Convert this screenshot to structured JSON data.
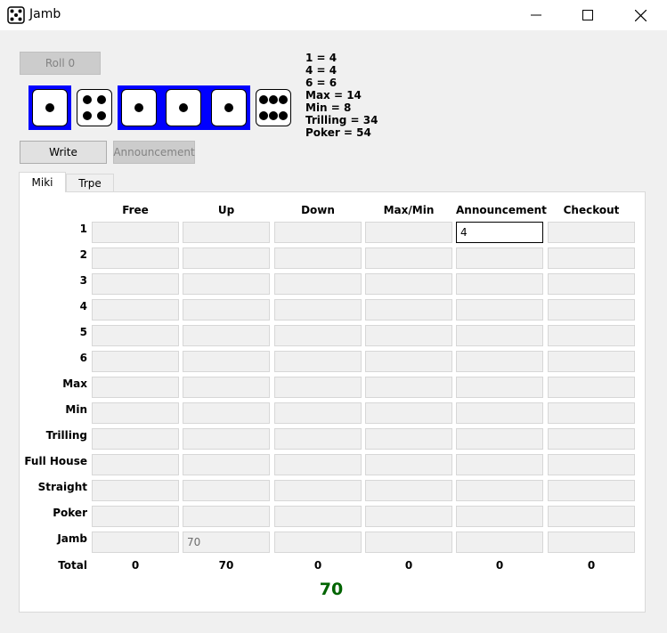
{
  "window": {
    "title": "Jamb",
    "app_icon": "dice-icon"
  },
  "controls": {
    "roll_label": "Roll 0",
    "write_label": "Write",
    "announcement_label": "Announcement"
  },
  "dice": [
    {
      "value": 1,
      "held": true
    },
    {
      "value": 4,
      "held": false
    },
    {
      "value": 1,
      "held": true
    },
    {
      "value": 1,
      "held": true
    },
    {
      "value": 1,
      "held": true
    },
    {
      "value": 6,
      "held": false
    }
  ],
  "info_lines": [
    "1 = 4",
    "4 = 4",
    "6 = 6",
    "Max = 14",
    "Min = 8",
    "Trilling = 34",
    "Poker = 54"
  ],
  "tabs": [
    {
      "label": "Miki",
      "active": true
    },
    {
      "label": "Trpe",
      "active": false
    }
  ],
  "columns": [
    "Free",
    "Up",
    "Down",
    "Max/Min",
    "Announcement",
    "Checkout"
  ],
  "rows": [
    "1",
    "2",
    "3",
    "4",
    "5",
    "6",
    "Max",
    "Min",
    "Trilling",
    "Full House",
    "Straight",
    "Poker",
    "Jamb"
  ],
  "cells": [
    [
      "",
      "",
      "",
      "",
      "4",
      ""
    ],
    [
      "",
      "",
      "",
      "",
      "",
      ""
    ],
    [
      "",
      "",
      "",
      "",
      "",
      ""
    ],
    [
      "",
      "",
      "",
      "",
      "",
      ""
    ],
    [
      "",
      "",
      "",
      "",
      "",
      ""
    ],
    [
      "",
      "",
      "",
      "",
      "",
      ""
    ],
    [
      "",
      "",
      "",
      "",
      "",
      ""
    ],
    [
      "",
      "",
      "",
      "",
      "",
      ""
    ],
    [
      "",
      "",
      "",
      "",
      "",
      ""
    ],
    [
      "",
      "",
      "",
      "",
      "",
      ""
    ],
    [
      "",
      "",
      "",
      "",
      "",
      ""
    ],
    [
      "",
      "",
      "",
      "",
      "",
      ""
    ],
    [
      "",
      "70",
      "",
      "",
      "",
      ""
    ]
  ],
  "active_cell": {
    "row": 0,
    "col": 4
  },
  "total_label": "Total",
  "totals": [
    "0",
    "70",
    "0",
    "0",
    "0",
    "0"
  ],
  "grand_total": "70"
}
